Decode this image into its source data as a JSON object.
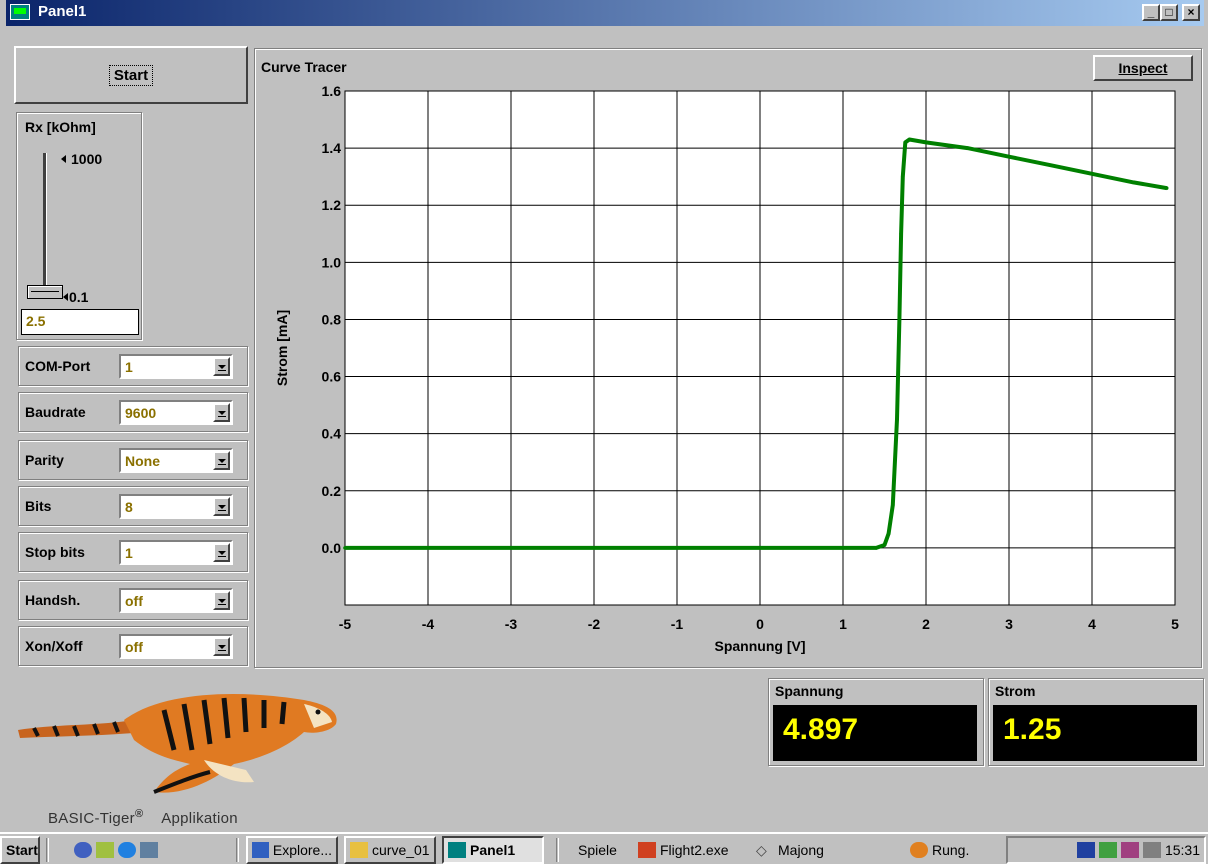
{
  "window": {
    "title": "Panel1",
    "controls": {
      "minimize": "_",
      "maximize": "□",
      "close": "×"
    }
  },
  "left_panel": {
    "start_label": "Start",
    "rx": {
      "label": "Rx [kOhm]",
      "max_label": "1000",
      "min_label": "0.1",
      "value": "2.5",
      "slider_level": 0.0
    }
  },
  "combos": [
    {
      "key": "com_port",
      "label": "COM-Port",
      "value": "1"
    },
    {
      "key": "baudrate",
      "label": "Baudrate",
      "value": "9600"
    },
    {
      "key": "parity",
      "label": "Parity",
      "value": "None"
    },
    {
      "key": "bits",
      "label": "Bits",
      "value": "8"
    },
    {
      "key": "stop_bits",
      "label": "Stop bits",
      "value": "1"
    },
    {
      "key": "handshake",
      "label": "Handsh.",
      "value": "off"
    },
    {
      "key": "xon_xoff",
      "label": "Xon/Xoff",
      "value": "off"
    }
  ],
  "chart_panel": {
    "title": "Curve Tracer",
    "inspect_label": "Inspect"
  },
  "chart_data": {
    "type": "line",
    "title": "Curve Tracer",
    "xlabel": "Spannung [V]",
    "ylabel": "Strom [mA]",
    "xlim": [
      -5,
      5
    ],
    "ylim": [
      -0.2,
      1.6
    ],
    "xticks": [
      -5,
      -4,
      -3,
      -2,
      -1,
      0,
      1,
      2,
      3,
      4,
      5
    ],
    "yticks": [
      "0.0",
      "0.2",
      "0.4",
      "0.6",
      "0.8",
      "1.0",
      "1.2",
      "1.4",
      "1.6"
    ],
    "grid": true,
    "color": "#008000",
    "series": [
      {
        "x": [
          -5.0,
          -4.0,
          -3.0,
          -2.0,
          -1.0,
          0.0,
          1.0,
          1.4,
          1.5,
          1.55,
          1.6,
          1.65,
          1.68,
          1.7,
          1.72,
          1.75,
          1.8,
          2.0,
          2.5,
          3.0,
          3.5,
          4.0,
          4.5,
          4.9
        ],
        "y": [
          0.0,
          0.0,
          0.0,
          0.0,
          0.0,
          0.0,
          0.0,
          0.0,
          0.01,
          0.05,
          0.15,
          0.45,
          0.8,
          1.1,
          1.3,
          1.42,
          1.43,
          1.42,
          1.4,
          1.37,
          1.34,
          1.31,
          1.28,
          1.26
        ]
      }
    ]
  },
  "readouts": {
    "spannung": {
      "label": "Spannung",
      "value": "4.897"
    },
    "strom": {
      "label": "Strom",
      "value": "1.25"
    }
  },
  "logo": {
    "brand": "BASIC-Tiger",
    "reg": "®",
    "suffix": "Applikation"
  },
  "taskbar": {
    "start": "Start",
    "buttons": [
      {
        "label": "Explore...",
        "active": false
      },
      {
        "label": "curve_01",
        "active": false
      },
      {
        "label": "Panel1",
        "active": true
      }
    ],
    "quick": [
      {
        "label": "Spiele"
      },
      {
        "label": "Flight2.exe"
      },
      {
        "label": "Majong"
      },
      {
        "label": "Rung."
      }
    ],
    "clock": "15:31"
  }
}
